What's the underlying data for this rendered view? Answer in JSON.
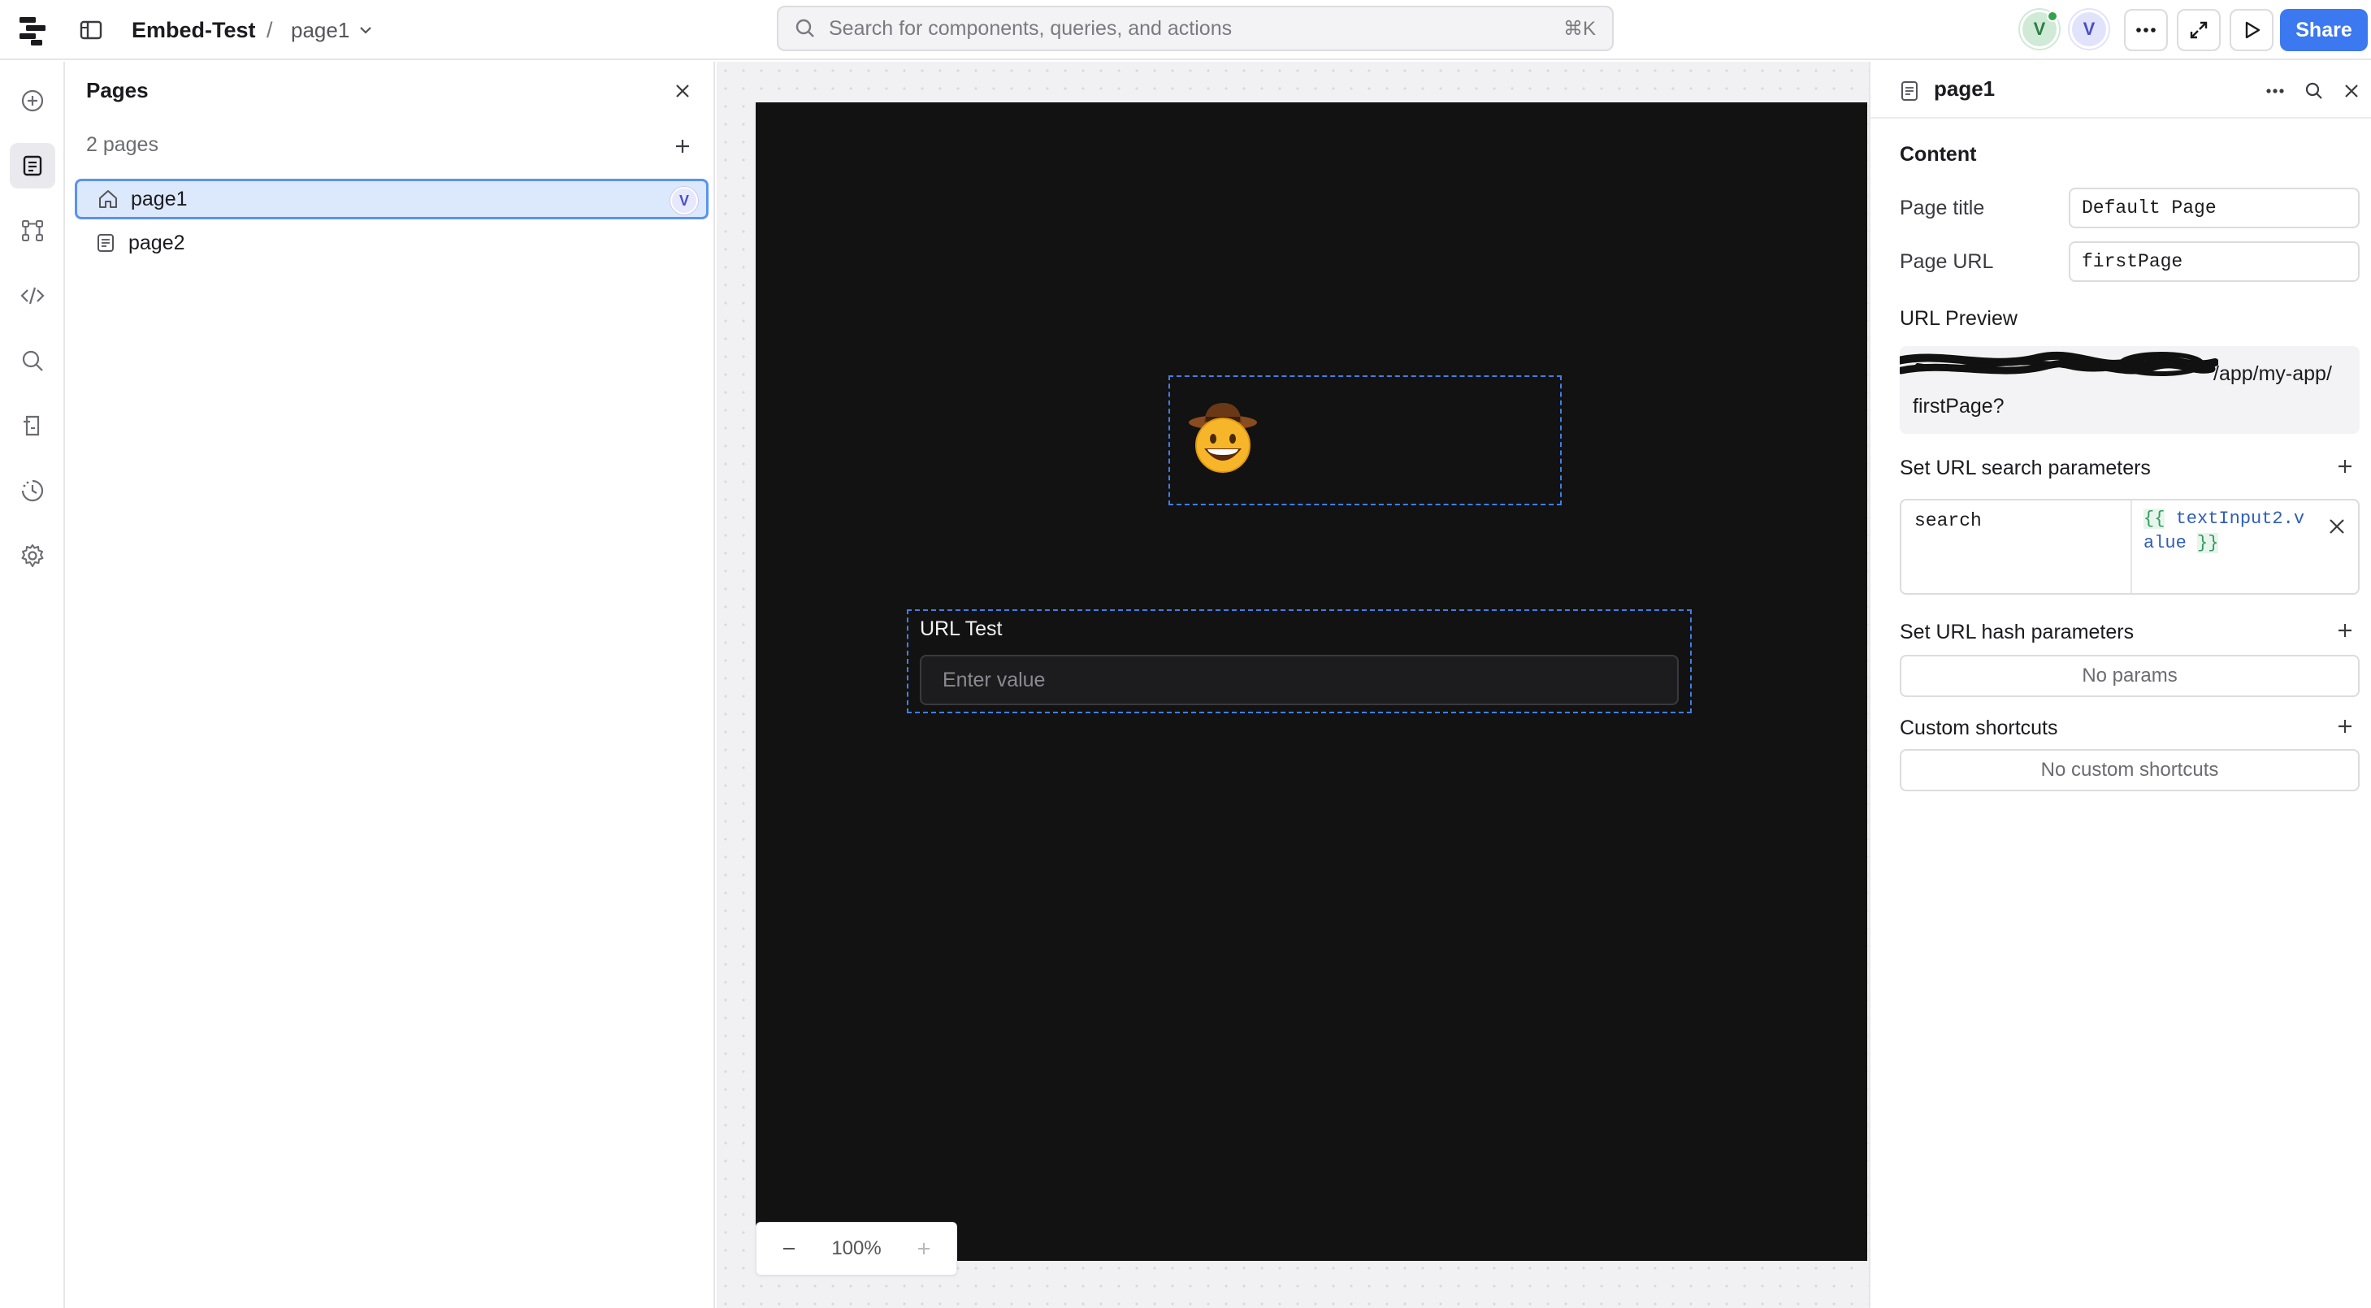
{
  "topbar": {
    "app_name": "Embed-Test",
    "separator": "/",
    "current_page": "page1",
    "search_placeholder": "Search for components, queries, and actions",
    "search_shortcut": "⌘K",
    "avatars": [
      "V",
      "V"
    ],
    "share_label": "Share"
  },
  "rail": {
    "icons": [
      "add-component-icon",
      "pages-icon",
      "component-tree-icon",
      "code-icon",
      "search-icon",
      "state-icon",
      "history-icon",
      "settings-icon"
    ]
  },
  "pages_panel": {
    "title": "Pages",
    "count_label": "2 pages",
    "pages": [
      {
        "label": "page1",
        "badge": "V"
      },
      {
        "label": "page2"
      }
    ]
  },
  "canvas": {
    "input_label": "URL Test",
    "input_placeholder": "Enter value",
    "zoom": "100%",
    "background": "#121212",
    "selection_color": "#3f7fe8"
  },
  "inspector": {
    "title": "page1",
    "content_heading": "Content",
    "page_title_label": "Page title",
    "page_title_value": "Default Page",
    "page_url_label": "Page URL",
    "page_url_value": "firstPage",
    "url_preview_label": "URL Preview",
    "url_preview_tail": "/app/my-app/",
    "url_preview_line2": "firstPage?",
    "search_params_label": "Set URL search parameters",
    "search_param_key": "search",
    "search_param_open": "{{",
    "search_param_expr": "textInput2.value",
    "search_param_close": "}}",
    "hash_params_label": "Set URL hash parameters",
    "hash_params_empty": "No params",
    "shortcuts_label": "Custom shortcuts",
    "shortcuts_empty": "No custom shortcuts"
  },
  "colors": {
    "accent": "#3c78f0",
    "selected_row": "#dce8fb"
  }
}
